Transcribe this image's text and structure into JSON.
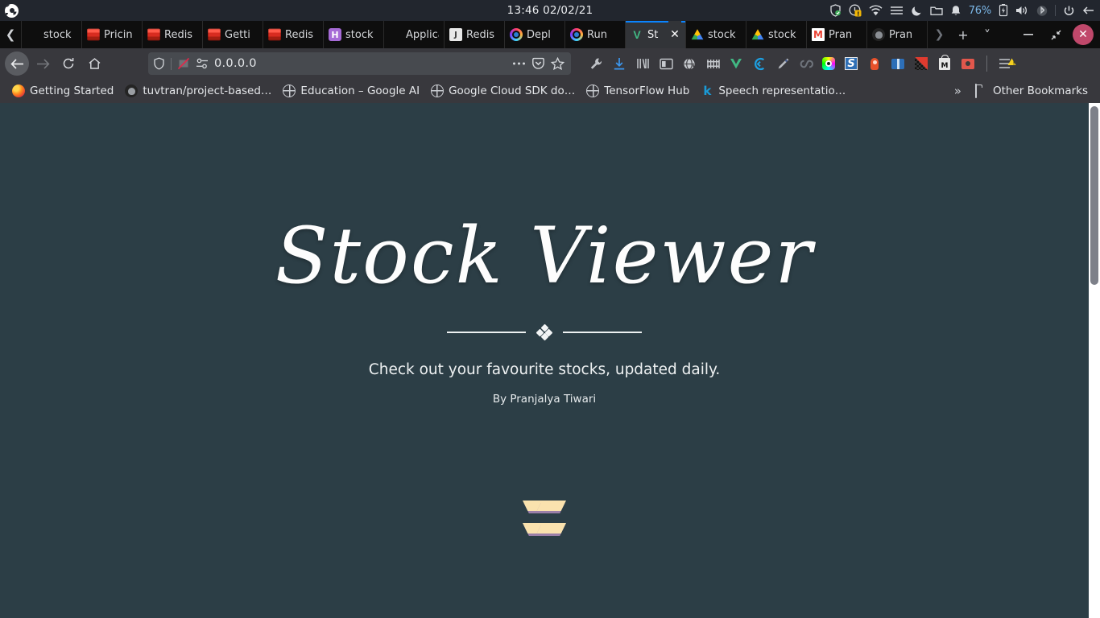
{
  "system_bar": {
    "logo_icon": "system-logo-icon",
    "clock": "13:46  02/02/21",
    "tray": [
      {
        "name": "shield-check-icon",
        "label": ""
      },
      {
        "name": "clock-warning-icon",
        "label": ""
      },
      {
        "name": "wifi-icon",
        "label": ""
      },
      {
        "name": "menu-lines-icon",
        "label": ""
      },
      {
        "name": "moon-night-mode-icon",
        "label": ""
      },
      {
        "name": "folder-icon",
        "label": ""
      },
      {
        "name": "bell-notification-icon",
        "label": ""
      },
      {
        "name": "battery-percent",
        "label": "76%"
      },
      {
        "name": "battery-icon",
        "label": ""
      },
      {
        "name": "volume-icon",
        "label": ""
      },
      {
        "name": "bluetooth-icon",
        "label": ""
      },
      {
        "name": "power-icon",
        "label": ""
      },
      {
        "name": "logout-icon",
        "label": ""
      }
    ]
  },
  "tab_strip": {
    "scroll_left_icon": "chevron-left-icon",
    "tabs": [
      {
        "title": "stock",
        "favicon": "blank",
        "active": false
      },
      {
        "title": "Pricin",
        "favicon": "redis",
        "active": false
      },
      {
        "title": "Redis",
        "favicon": "redis",
        "active": false
      },
      {
        "title": "Getti",
        "favicon": "redis",
        "active": false
      },
      {
        "title": "Redis",
        "favicon": "redis",
        "active": false
      },
      {
        "title": "stock",
        "favicon": "heroku",
        "active": false
      },
      {
        "title": "Applicat",
        "favicon": "blank",
        "active": false
      },
      {
        "title": "Redis",
        "favicon": "java",
        "active": false
      },
      {
        "title": "Depl",
        "favicon": "deploy",
        "active": false
      },
      {
        "title": "Run",
        "favicon": "deploy",
        "active": false
      },
      {
        "title": "St",
        "favicon": "vue",
        "active": true
      },
      {
        "title": "stock",
        "favicon": "drive",
        "active": false
      },
      {
        "title": "stock",
        "favicon": "drive",
        "active": false
      },
      {
        "title": "Pran",
        "favicon": "gmail",
        "active": false
      },
      {
        "title": "Pran",
        "favicon": "github",
        "active": false
      }
    ],
    "close_label": "✕",
    "overflow_icon": "chevron-right-icon",
    "new_tab_label": "+",
    "tab_list_icon": "chevron-down-icon",
    "window_minimize": "—",
    "window_restore": "⤡",
    "window_close": "✕"
  },
  "nav_bar": {
    "back_icon": "back-arrow-icon",
    "forward_icon": "forward-arrow-icon",
    "reload_icon": "reload-icon",
    "home_icon": "home-icon",
    "shield_icon": "tracking-protection-shield-icon",
    "reader_blocked_icon": "reader-mode-blocked-icon",
    "permissions_icon": "site-permissions-icon",
    "url": "0.0.0.0",
    "page_actions_icon": "ellipsis-icon",
    "pocket_icon": "pocket-icon",
    "bookmark_star_icon": "bookmark-star-icon",
    "toolbar_icons": [
      {
        "name": "wrench-devtools-icon"
      },
      {
        "name": "downloads-icon"
      },
      {
        "name": "library-icon"
      },
      {
        "name": "sidebar-icon"
      },
      {
        "name": "shield-alert-icon"
      },
      {
        "name": "grid-columns-icon"
      },
      {
        "name": "vue-devtools-icon"
      },
      {
        "name": "c-extension-icon"
      },
      {
        "name": "pen-extension-icon"
      },
      {
        "name": "loop-extension-icon"
      },
      {
        "name": "color-ring-extension-icon"
      },
      {
        "name": "s-extension-icon"
      },
      {
        "name": "fire-extension-icon"
      },
      {
        "name": "package-extension-icon"
      },
      {
        "name": "checker-triangle-extension-icon"
      },
      {
        "name": "m-lock-extension-icon"
      },
      {
        "name": "camera-extension-icon"
      }
    ],
    "menu_icon": "app-menu-icon-with-warning"
  },
  "bookmarks_bar": {
    "items": [
      {
        "label": "Getting Started",
        "icon": "firefox"
      },
      {
        "label": "tuvtran/project-based…",
        "icon": "github"
      },
      {
        "label": "Education – Google AI",
        "icon": "globe"
      },
      {
        "label": "Google Cloud SDK do…",
        "icon": "globe"
      },
      {
        "label": "TensorFlow Hub",
        "icon": "globe"
      },
      {
        "label": "Speech representatio…",
        "icon": "k"
      }
    ],
    "overflow_icon": "double-chevron-right-icon",
    "other_bookmarks": {
      "label": "Other Bookmarks",
      "icon": "folder"
    }
  },
  "page": {
    "title": "Stock Viewer",
    "divider_ornament_icon": "diamond-cluster-ornament-icon",
    "subtitle": "Check out your favourite stocks, updated daily.",
    "byline": "By Pranjalya Tiwari",
    "scroll_down_icon": "double-chevron-down-icon",
    "colors": {
      "background": "#2c3e46",
      "text": "#fdfdfd",
      "chevron_face": "#fae2ae",
      "chevron_shadow": "#9b7fa8"
    }
  },
  "scrollbar": {
    "name": "page-scrollbar"
  }
}
